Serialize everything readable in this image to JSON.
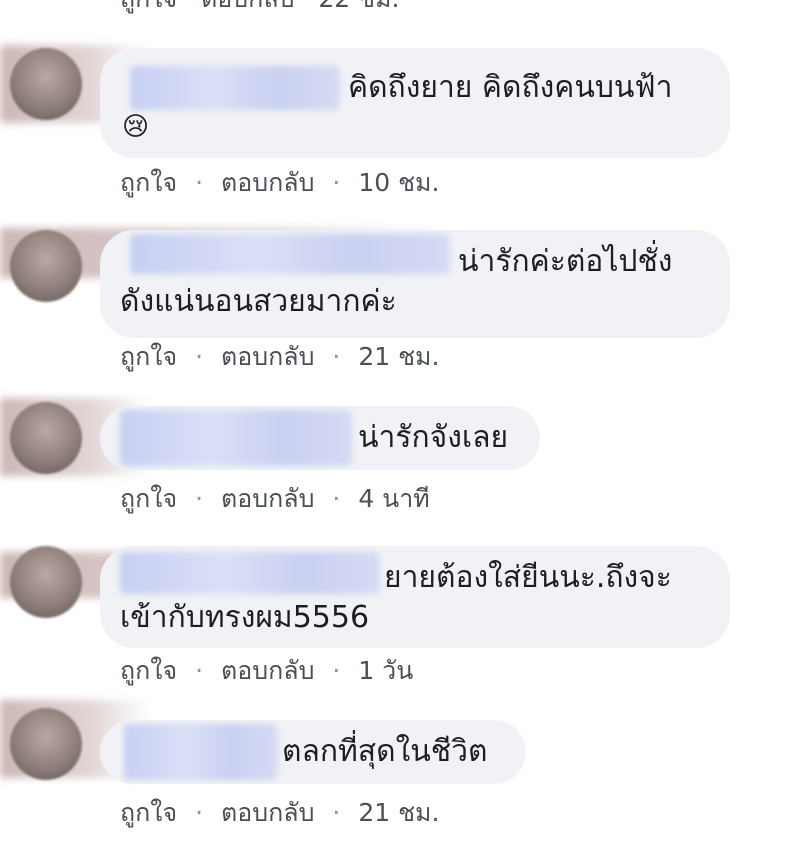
{
  "actions": {
    "like": "ถูกใจ",
    "reply": "ตอบกลับ",
    "separator": "·"
  },
  "top_cut_time": "22 ชม.",
  "comments": [
    {
      "text_line1": "คิดถึงยาย คิดถึงคนบนฟ้า",
      "text_line2": "",
      "emoji": "😢",
      "time": "10 ชม."
    },
    {
      "text_line1": "น่ารักค่ะต่อไปชั่ง",
      "text_line2": "ดังแน่นอนสวยมากค่ะ",
      "emoji": "",
      "time": "21 ชม."
    },
    {
      "text_line1": "น่ารักจังเลย",
      "text_line2": "",
      "emoji": "",
      "time": "4 นาที"
    },
    {
      "text_line1": "ยายต้องใส่ยีนนะ.ถึงจะ",
      "text_line2": "เข้ากับทรงผม5556",
      "emoji": "",
      "time": "1 วัน"
    },
    {
      "text_line1": "ตลกที่สุดในชีวิต",
      "text_line2": "",
      "emoji": "",
      "time": "21 ชม."
    }
  ]
}
